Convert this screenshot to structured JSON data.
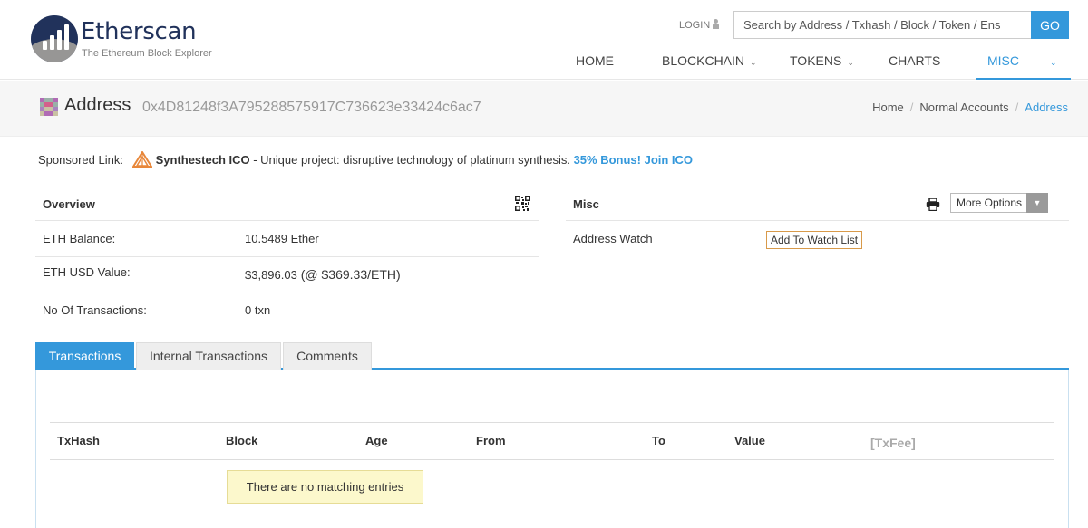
{
  "brand": {
    "name": "Etherscan",
    "tagline": "The Ethereum Block Explorer",
    "primary_color": "#21325b",
    "accent_color": "#3498db"
  },
  "header": {
    "login_label": "LOGIN",
    "search_placeholder": "Search by Address / Txhash / Block / Token / Ens",
    "search_value": "",
    "go_label": "GO"
  },
  "nav": [
    {
      "label": "HOME",
      "has_menu": false
    },
    {
      "label": "BLOCKCHAIN",
      "has_menu": true
    },
    {
      "label": "TOKENS",
      "has_menu": true
    },
    {
      "label": "CHARTS",
      "has_menu": false
    },
    {
      "label": "MISC",
      "has_menu": true,
      "active": true
    }
  ],
  "page": {
    "title": "Address",
    "address": "0x4D81248f3A795288575917C736623e33424c6ac7",
    "breadcrumb": [
      "Home",
      "Normal Accounts",
      "Address"
    ]
  },
  "sponsored": {
    "prefix": "Sponsored Link:",
    "name": "Synthestech ICO",
    "text": " - Unique project: disruptive technology of platinum synthesis. ",
    "cta": "35% Bonus! Join ICO"
  },
  "overview": {
    "title": "Overview",
    "rows": [
      {
        "key": "ETH Balance:",
        "value": "10.5489 Ether"
      },
      {
        "key": "ETH USD Value:",
        "value": "$3,896.03",
        "value_extra": " (@ $369.33/ETH)"
      },
      {
        "key": "No Of Transactions:",
        "value": "0 txn"
      }
    ]
  },
  "misc": {
    "title": "Misc",
    "more_options_label": "More Options",
    "address_watch_label": "Address Watch",
    "add_watch_label": "Add To Watch List"
  },
  "tabs": [
    {
      "label": "Transactions",
      "active": true
    },
    {
      "label": "Internal Transactions",
      "active": false
    },
    {
      "label": "Comments",
      "active": false
    }
  ],
  "table": {
    "columns": [
      "TxHash",
      "Block",
      "Age",
      "From",
      "To",
      "Value",
      "[TxFee]"
    ],
    "empty_message": "There are no matching entries"
  }
}
